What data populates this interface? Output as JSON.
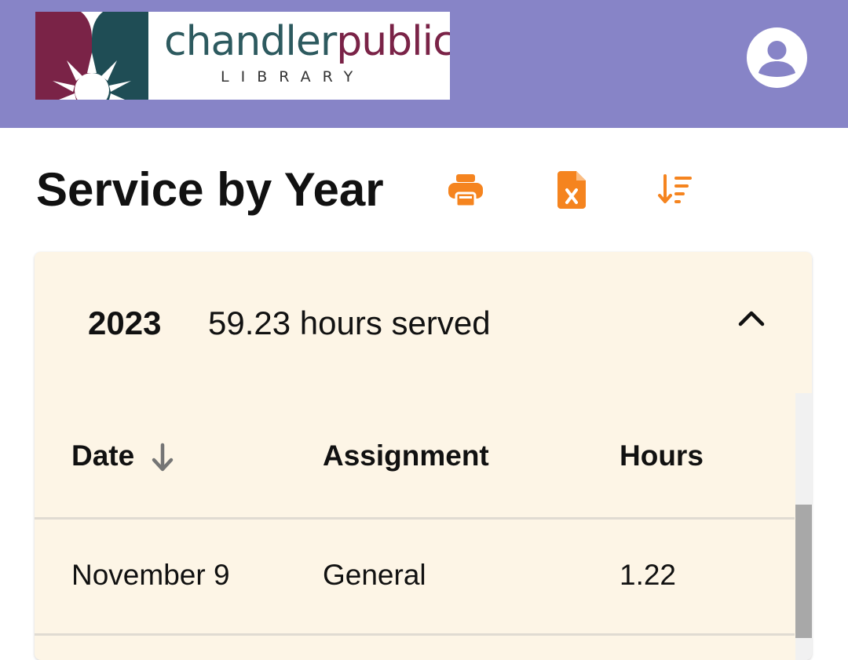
{
  "header": {
    "logo": {
      "word_main": "chandler",
      "word_accent": "public",
      "subtitle": "LIBRARY"
    },
    "account_icon": "account-circle-icon"
  },
  "page": {
    "title": "Service by Year",
    "toolbar": {
      "print_icon": "print-icon",
      "excel_icon": "excel-file-icon",
      "sort_icon": "sort-descending-icon"
    }
  },
  "year_panel": {
    "year": "2023",
    "summary": "59.23 hours served",
    "expanded": true,
    "table": {
      "columns": [
        "Date",
        "Assignment",
        "Hours"
      ],
      "sort_column": "Date",
      "sort_direction": "descending",
      "rows": [
        {
          "date": "November 9",
          "assignment": "General",
          "hours": "1.22"
        }
      ]
    }
  },
  "colors": {
    "app_bar": "#8784c7",
    "accent_orange": "#f5841f",
    "panel_bg": "#fdf5e6",
    "logo_teal": "#2d5a5f",
    "logo_maroon": "#7a2347"
  }
}
